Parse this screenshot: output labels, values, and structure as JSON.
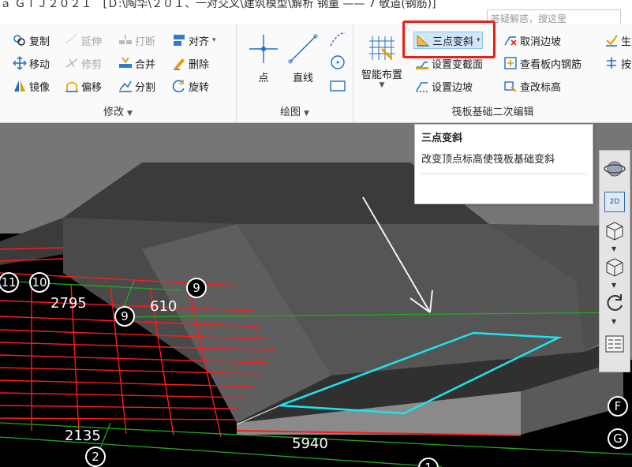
{
  "window": {
    "title": "ａ ＧＴＪ２０２１　[Ｄ:\\陶华\\２０１、一对交叉\\建筑模型\\解析 钢量 —— 7 敬道(钢筋)]",
    "search_placeholder": "答疑解惑，搜这里"
  },
  "ribbon": {
    "modify": {
      "label": "修改",
      "items": {
        "copy": "复制",
        "extend": "延伸",
        "break": "打断",
        "align": "对齐",
        "move": "移动",
        "trim": "修剪",
        "merge": "合并",
        "delete": "删除",
        "mirror": "镜像",
        "offset": "偏移",
        "split": "分割",
        "rotate": "旋转"
      }
    },
    "draw": {
      "label": "绘图",
      "point": "点",
      "line": "直线"
    },
    "raft": {
      "label": "筏板基础二次编辑",
      "smart_layout": "智能布置",
      "three_point_slope": "三点变斜",
      "set_section": "设置变截面",
      "set_slope": "设置边坡",
      "cancel_slope": "取消边坡",
      "view_rebar": "查看板内钢筋",
      "check_elevation": "查改标高",
      "gen_partial": "生",
      "gen_partial2": "按"
    }
  },
  "tooltip": {
    "title": "三点变斜",
    "description": "改变顶点标高使筏板基础变斜"
  },
  "viewport": {
    "dimensions": [
      "2795",
      "610",
      "2135",
      "5940"
    ],
    "axis_labels": [
      "11",
      "10",
      "9",
      "9",
      "2",
      "1",
      "F",
      "G"
    ],
    "view_toolbar": {
      "btn_2d": "2D"
    }
  },
  "colors": {
    "highlight": "#e8201a",
    "selection_outline": "#19e6f2",
    "grid_red": "#ff1a1a",
    "grid_green": "#1faa1f"
  }
}
